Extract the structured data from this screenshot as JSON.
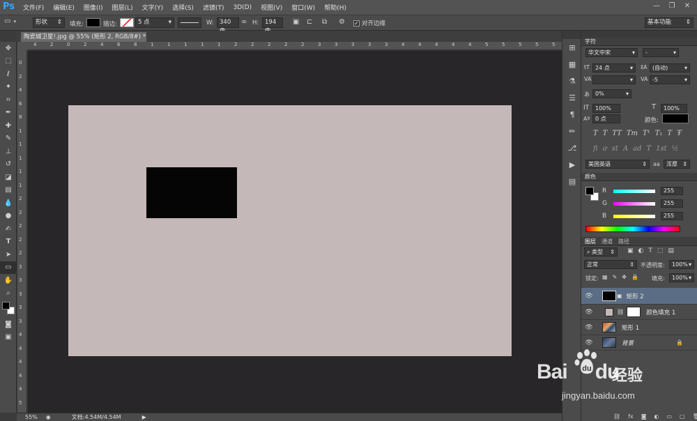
{
  "app": {
    "logo": "Ps",
    "workspace": "基本功能"
  },
  "menu": [
    "文件(F)",
    "编辑(E)",
    "图像(I)",
    "图层(L)",
    "文字(Y)",
    "选择(S)",
    "滤镜(T)",
    "3D(D)",
    "视图(V)",
    "窗口(W)",
    "帮助(H)"
  ],
  "options": {
    "mode": "形状",
    "fill_label": "填充:",
    "stroke_label": "描边:",
    "stroke_width": "5 点",
    "w_label": "W:",
    "w_value": "340 像",
    "h_label": "H:",
    "h_value": "194 像",
    "align_edges": "对齐边缘",
    "fill_color": "#000000"
  },
  "document": {
    "tab_title": "陶瓷城卫星!.jpg @ 55% (矩形 2, RGB/8#) *",
    "canvas_color": "#c4b9b8",
    "shape_color": "#050505"
  },
  "ruler_top": [
    "4",
    "2",
    "0",
    "2",
    "4",
    "6",
    "8",
    "1",
    "1",
    "1",
    "1",
    "1",
    "2",
    "2",
    "2",
    "2",
    "2",
    "3",
    "3",
    "3",
    "3",
    "3",
    "4",
    "4",
    "4",
    "4",
    "4",
    "5",
    "5",
    "5",
    "5",
    "5"
  ],
  "ruler_left": [
    "0",
    "2",
    "4",
    "6",
    "8",
    "1",
    "1",
    "1",
    "1",
    "1",
    "2",
    "2",
    "2",
    "2",
    "2",
    "3",
    "3",
    "3",
    "3",
    "3",
    "4",
    "4",
    "4",
    "4",
    "4",
    "5"
  ],
  "status": {
    "zoom": "55%",
    "doc": "文档:4.54M/4.54M"
  },
  "character": {
    "tab": "字符",
    "font": "华文中宋",
    "style": "-",
    "size": "24 点",
    "leading": "(自动)",
    "kerning": "",
    "tracking": "-5",
    "scale_pct": "0%",
    "vscale": "100%",
    "hscale": "100%",
    "baseline": "0 点",
    "color_label": "颜色:",
    "language": "美国英语",
    "aa_label": "aa",
    "antialias": "浑厚"
  },
  "color_panel": {
    "tab": "颜色",
    "channels": [
      {
        "name": "R",
        "value": "255"
      },
      {
        "name": "G",
        "value": "255"
      },
      {
        "name": "B",
        "value": "255"
      }
    ]
  },
  "layers_panel": {
    "tabs": [
      "图层",
      "通道",
      "路径"
    ],
    "filter": "类型",
    "blend": "正常",
    "opacity_label": "不透明度:",
    "opacity": "100%",
    "lock_label": "锁定:",
    "fill_label": "填充:",
    "fill": "100%",
    "layers": [
      {
        "name": "矩形 2"
      },
      {
        "name": "颜色填充 1"
      },
      {
        "name": "矩形 1"
      },
      {
        "name": "背景"
      }
    ]
  },
  "watermark": {
    "logo": "Bai",
    "logo_end": "du",
    "cn": "经验",
    "url": "jingyan.baidu.com"
  }
}
